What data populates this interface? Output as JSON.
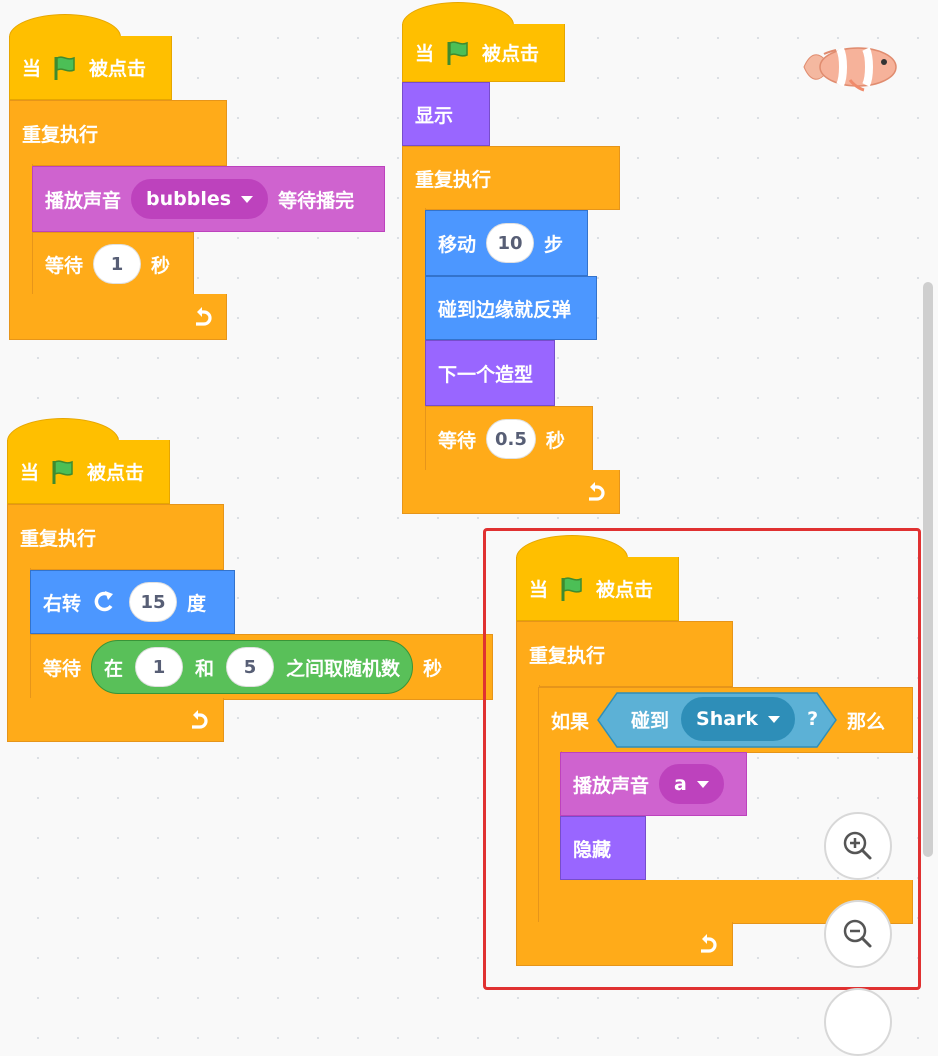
{
  "blocks": {
    "when_flag_clicked_prefix": "当",
    "when_flag_clicked_suffix": "被点击",
    "forever": "重复执行",
    "play_sound_until_done_prefix": "播放声音",
    "play_sound_until_done_suffix": "等待播完",
    "wait_prefix": "等待",
    "wait_suffix": "秒",
    "show": "显示",
    "move_prefix": "移动",
    "move_suffix": "步",
    "bounce": "碰到边缘就反弹",
    "next_costume": "下一个造型",
    "turn_right_prefix": "右转",
    "turn_right_suffix": "度",
    "random_prefix": "在",
    "random_and": "和",
    "random_suffix": "之间取随机数",
    "if_prefix": "如果",
    "if_suffix": "那么",
    "touching_prefix": "碰到",
    "touching_suffix": "?",
    "play_sound": "播放声音",
    "hide": "隐藏"
  },
  "values": {
    "sound_bubbles": "bubbles",
    "wait_1": "1",
    "move_steps": "10",
    "wait_half": "0.5",
    "turn_degrees": "15",
    "random_from": "1",
    "random_to": "5",
    "touch_target": "Shark",
    "sound_a": "a"
  },
  "colors": {
    "events": "#ffbf00",
    "control": "#ffab19",
    "sound": "#cf63cf",
    "motion": "#4c97ff",
    "looks": "#9966ff",
    "sensing": "#5cb1d6",
    "operators": "#59c059",
    "highlight": "#e03131"
  },
  "icons": [
    "green-flag-icon",
    "loop-arrow-icon",
    "turn-right-icon",
    "zoom-in-icon",
    "zoom-out-icon",
    "clownfish-sprite"
  ]
}
